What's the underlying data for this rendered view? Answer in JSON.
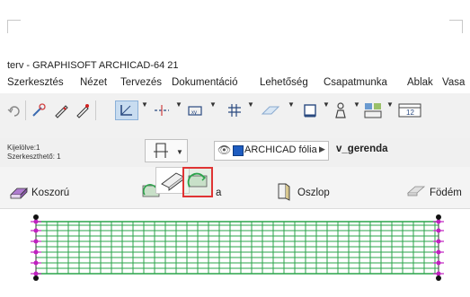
{
  "window": {
    "title": "terv - GRAPHISOFT ARCHICAD-64 21"
  },
  "menu": [
    "Szerkesztés",
    "Nézet",
    "Tervezés",
    "Dokumentáció",
    "Lehetőség",
    "Csapatmunka",
    "Ablak",
    "Vasa"
  ],
  "toolbar": {
    "icons": [
      "undo-icon",
      "magic-wand-icon",
      "pencil-icon",
      "pen-icon",
      "arrow-tool-icon",
      "align-icon",
      "dimension-icon",
      "grid-snap-icon",
      "plane-icon",
      "shape-icon",
      "figure-icon",
      "layout-icon",
      "table-icon"
    ],
    "zoom_badge": "12"
  },
  "info_box": {
    "selected_label": "Kijelölve:1",
    "editable_label": "Szerkeszthető: 1",
    "layer_name": "ARCHICAD fólia",
    "element_id": "v_gerenda"
  },
  "tools": {
    "koszoru": "Koszorú",
    "gerenda_partial": "a",
    "oszlop": "Oszlop",
    "fodem": "Födém"
  },
  "colors": {
    "beam_green": "#2aa34a",
    "node_magenta": "#c020c0",
    "highlight_red": "#e03434"
  }
}
